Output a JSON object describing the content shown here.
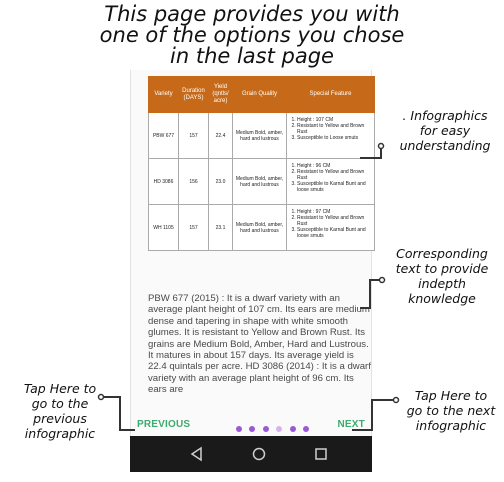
{
  "header": {
    "title_lines": [
      "This page provides you with",
      "one of the options you chose",
      "in the last page"
    ]
  },
  "table": {
    "headers": [
      "Variety",
      "Duration (DAYS)",
      "Yield (qntls/ acre)",
      "Grain Quality",
      "Special Feature"
    ],
    "rows": [
      {
        "variety": "PBW 677",
        "duration": "157",
        "yield": "22.4",
        "grain": "Medium Bold, amber, hard and lustrous",
        "features": [
          "Height : 107 CM",
          "Resistant to Yellow and Brown Rust",
          "Susceptible to Loose smuts"
        ]
      },
      {
        "variety": "HD 3086",
        "duration": "156",
        "yield": "23.0",
        "grain": "Medium Bold, amber, hard and lustrous",
        "features": [
          "Height : 96 CM",
          "Resistant to Yellow and Brown Rust",
          "Susceptible to Karnal Bunt and loose smuts"
        ]
      },
      {
        "variety": "WH 1105",
        "duration": "157",
        "yield": "23.1",
        "grain": "Medium Bold, amber, hard and lustrous",
        "features": [
          "Height : 97 CM",
          "Resistant to Yellow and Brown Rust",
          "Susceptible to Karnal Bunt and loose smuts"
        ]
      }
    ]
  },
  "description": "PBW 677 (2015) : It is a dwarf variety with an average plant height of 107 cm. Its ears are medium dense and tapering in shape with white smooth glumes. It is resistant to Yellow and Brown Rust. Its grains are Medium Bold, Amber, Hard and Lustrous. It matures in about 157 days. Its average yield is 22.4 quintals per acre.  HD 3086 (2014) : It is a dwarf variety with an average plant height of 96 cm. Its ears are",
  "navigation": {
    "prev_label": "PREVIOUS",
    "next_label": "NEXT",
    "dots": [
      {
        "color": "#9b59d6"
      },
      {
        "color": "#9b59d6"
      },
      {
        "color": "#9b59d6"
      },
      {
        "color": "#d9b3f0"
      },
      {
        "color": "#9b59d6"
      },
      {
        "color": "#9b59d6"
      }
    ]
  },
  "system_bar": {
    "icons": [
      "back-triangle-icon",
      "home-circle-icon",
      "recents-square-icon"
    ]
  },
  "annotations": {
    "infographics": [
      ". Infographics",
      "for easy",
      "understanding"
    ],
    "text": [
      "Corresponding",
      "text to provide",
      "indepth",
      "knowledge"
    ],
    "prev": [
      "Tap Here to",
      "go to the",
      "previous",
      "infographic"
    ],
    "next": [
      "Tap Here to",
      "go to the next",
      "infographic"
    ]
  },
  "colors": {
    "table_header": "#c66a1a",
    "nav_text": "#3daa6e",
    "dot_active": "#9b59d6",
    "system_bar": "#1a1a1a"
  }
}
